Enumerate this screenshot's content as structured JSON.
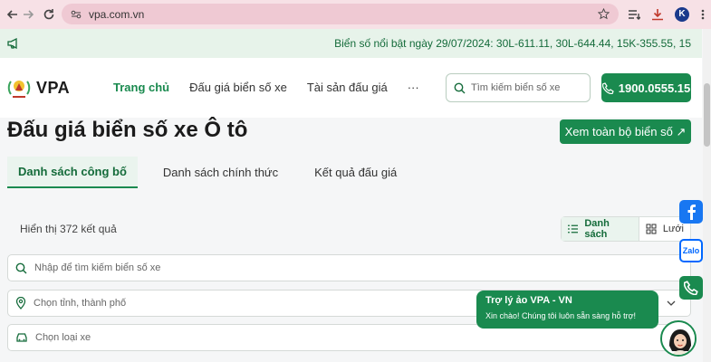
{
  "browser": {
    "url": "vpa.com.vn",
    "profile_initial": "K"
  },
  "ticker": {
    "text": "Biển số nổi bật ngày 29/07/2024: 30L-611.11, 30L-644.44, 15K-355.55, 15"
  },
  "header": {
    "logo_text": "VPA",
    "nav": [
      "Trang chủ",
      "Đấu giá biển số xe",
      "Tài sản đấu giá",
      "···"
    ],
    "search_placeholder": "Tìm kiếm biển số xe",
    "hotline": "1900.0555.15"
  },
  "page": {
    "title": "Đấu giá biển số xe Ô tô",
    "view_all_label": "Xem toàn bộ biển số ↗",
    "tabs": [
      "Danh sách công bố",
      "Danh sách chính thức",
      "Kết quả đấu giá"
    ],
    "result_count": "Hiển thị 372 kết quả",
    "view_list": "Danh sách",
    "view_grid": "Lưới"
  },
  "filters": {
    "search_plate": "Nhập để tìm kiếm biển số xe",
    "province": "Chọn tỉnh, thành phố",
    "vehicle_type": "Chọn loại xe"
  },
  "social": {
    "zalo_label": "Zalo"
  },
  "chat": {
    "title": "Trợ lý ảo VPA - VN",
    "message": "Xin chào! Chúng tôi luôn sẵn sàng hỗ trợ!"
  },
  "colors": {
    "brand_green": "#1a8a4f",
    "facebook_blue": "#1877f2",
    "zalo_blue": "#0068ff"
  }
}
